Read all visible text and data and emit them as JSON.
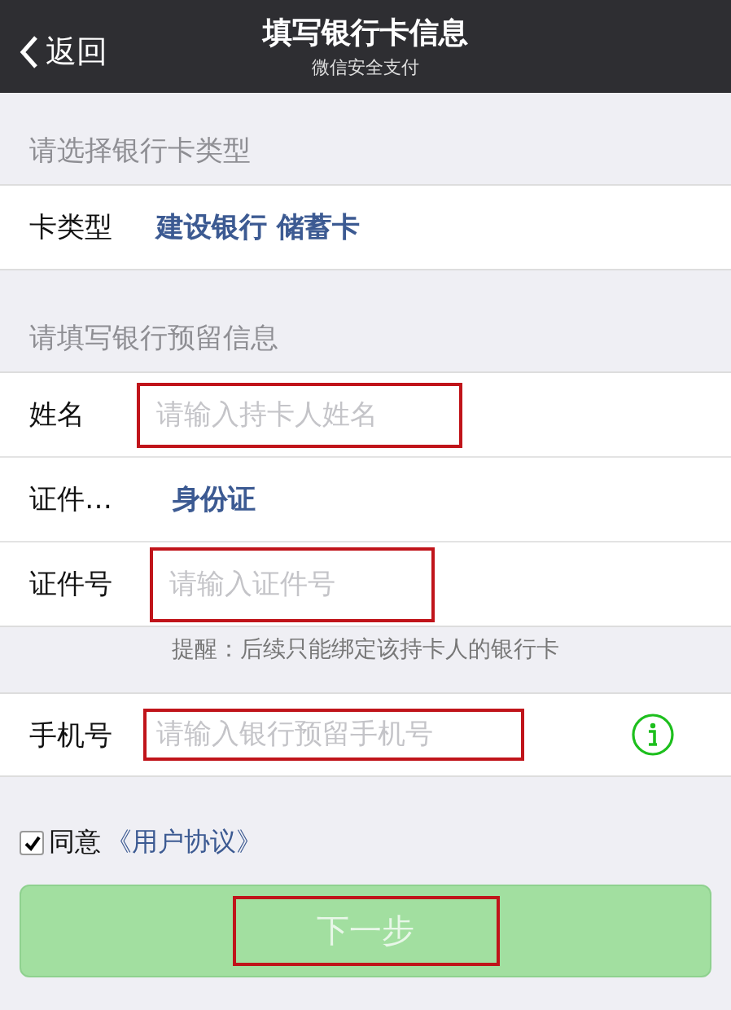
{
  "nav": {
    "back": "返回",
    "title": "填写银行卡信息",
    "subtitle": "微信安全支付"
  },
  "card_section": {
    "header": "请选择银行卡类型",
    "rows": [
      {
        "kind": "value",
        "label": "卡类型",
        "value": "建设银行 储蓄卡"
      }
    ]
  },
  "info_section": {
    "header": "请填写银行预留信息",
    "rows": [
      {
        "kind": "input",
        "label": "姓名",
        "placeholder": "请输入持卡人姓名",
        "highlighted": true
      },
      {
        "kind": "value",
        "label": "证件…",
        "value": "身份证"
      },
      {
        "kind": "input",
        "label": "证件号",
        "placeholder": "请输入证件号",
        "highlighted": true
      }
    ]
  },
  "tip": "提醒：后续只能绑定该持卡人的银行卡",
  "phone_section": {
    "rows": [
      {
        "kind": "input",
        "label": "手机号",
        "placeholder": "请输入银行预留手机号",
        "highlighted": true,
        "info": true
      }
    ]
  },
  "agreement": {
    "checked": true,
    "text": "同意",
    "link": "《用户协议》"
  },
  "next_button": {
    "label": "下一步",
    "disabled": true,
    "highlighted": true
  }
}
